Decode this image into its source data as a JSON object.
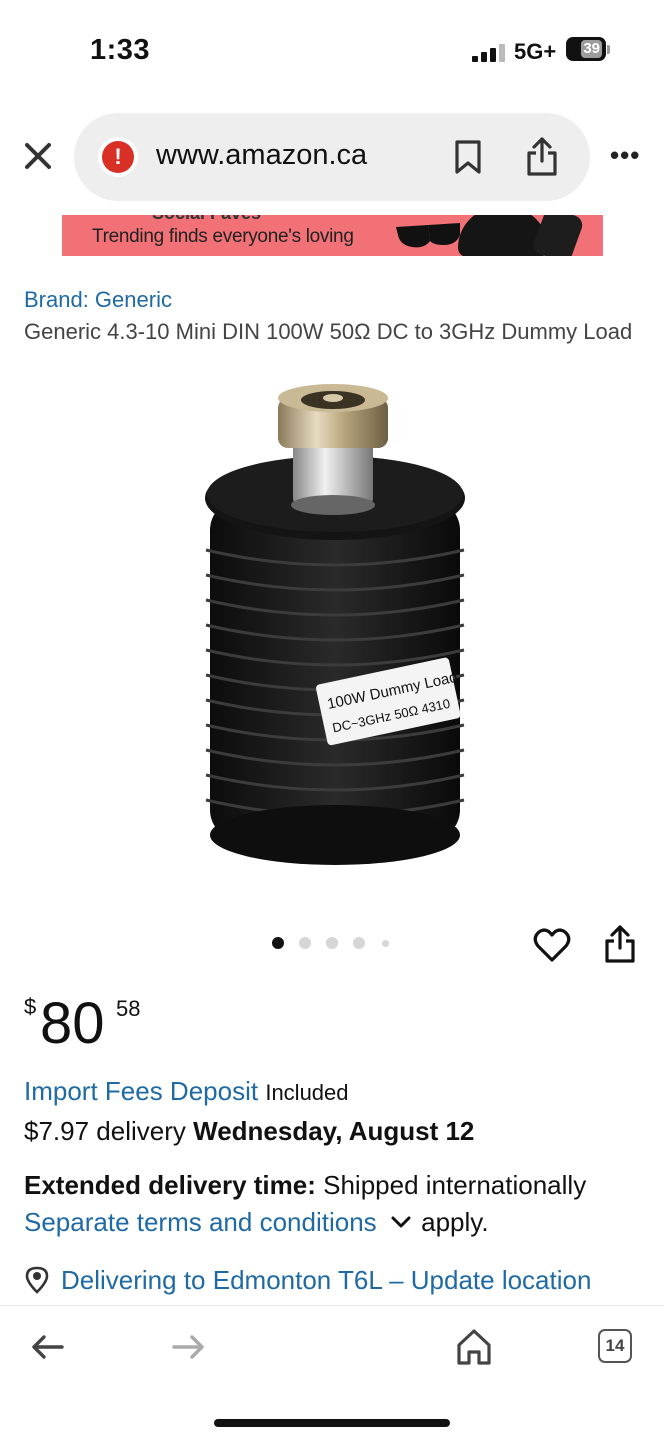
{
  "status_bar": {
    "time": "1:33",
    "network": "5G+",
    "battery": "39"
  },
  "browser": {
    "url": "www.amazon.ca",
    "icons": [
      "close-icon",
      "warning-icon",
      "bookmark-icon",
      "share-icon",
      "more-icon"
    ]
  },
  "banner": {
    "top_text": "Social Faves",
    "text": "Trending finds everyone's loving"
  },
  "product": {
    "brand": "Brand: Generic",
    "title": "Generic 4.3-10 Mini DIN 100W 50Ω DC to 3GHz Dummy Load",
    "image_label_line1": "100W Dummy Load",
    "image_label_line2": "DC~3GHz 50Ω 4310",
    "image_index": 1,
    "image_count": 5
  },
  "price": {
    "currency": "$",
    "whole": "80",
    "fraction": "58"
  },
  "fees": {
    "link": "Import Fees Deposit",
    "suffix": "Included"
  },
  "delivery": {
    "prefix": "$7.97 delivery",
    "date": "Wednesday, August 12"
  },
  "extended": {
    "label": "Extended delivery time:",
    "value": "Shipped internationally"
  },
  "terms": {
    "link": "Separate terms and conditions",
    "suffix": "apply."
  },
  "location": {
    "text": "Delivering to Edmonton T6L – Update location"
  },
  "bottom_nav": {
    "tab_count": "14"
  },
  "colors": {
    "link": "#1f6aa5",
    "banner": "#f27176",
    "warning": "#d93025"
  }
}
